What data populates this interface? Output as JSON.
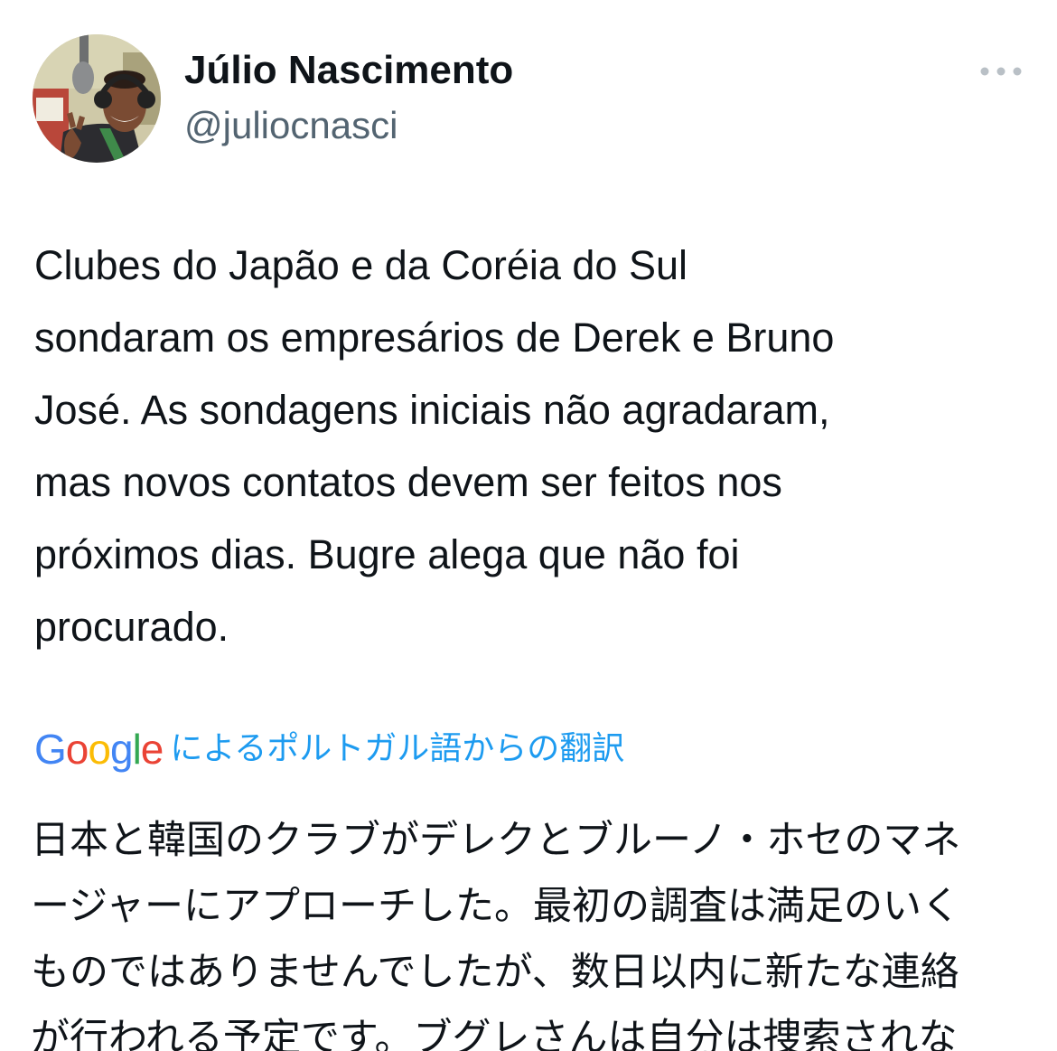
{
  "author": {
    "display_name": "Júlio Nascimento",
    "handle": "@juliocnasci",
    "avatar": "profile-photo"
  },
  "header": {
    "more_icon": "more-horizontal-icon"
  },
  "tweet": {
    "text": "Clubes do Japão e da Coréia do Sul\nsondaram os empresários de Derek e Bruno\nJosé. As sondagens iniciais não agradaram,\nmas novos contatos devem ser feitos nos\npróximos dias. Bugre alega que não foi\nprocurado."
  },
  "translation": {
    "logo": {
      "letters": [
        "G",
        "o",
        "o",
        "g",
        "l",
        "e"
      ],
      "colors": [
        "#4285F4",
        "#EA4335",
        "#FBBC05",
        "#4285F4",
        "#34A853",
        "#EA4335"
      ]
    },
    "label": "によるポルトガル語からの翻訳",
    "text": "日本と韓国のクラブがデレクとブルーノ・ホセのマネ\nージャーにアプローチした。最初の調査は満足のいく\nものではありませんでしたが、数日以内に新たな連絡\nが行われる予定です。ブグレさんは自分は捜索されな"
  },
  "colors": {
    "text": "#0f1419",
    "secondary": "#536471",
    "link": "#1d9bf0",
    "icon": "#b9c0c6"
  }
}
